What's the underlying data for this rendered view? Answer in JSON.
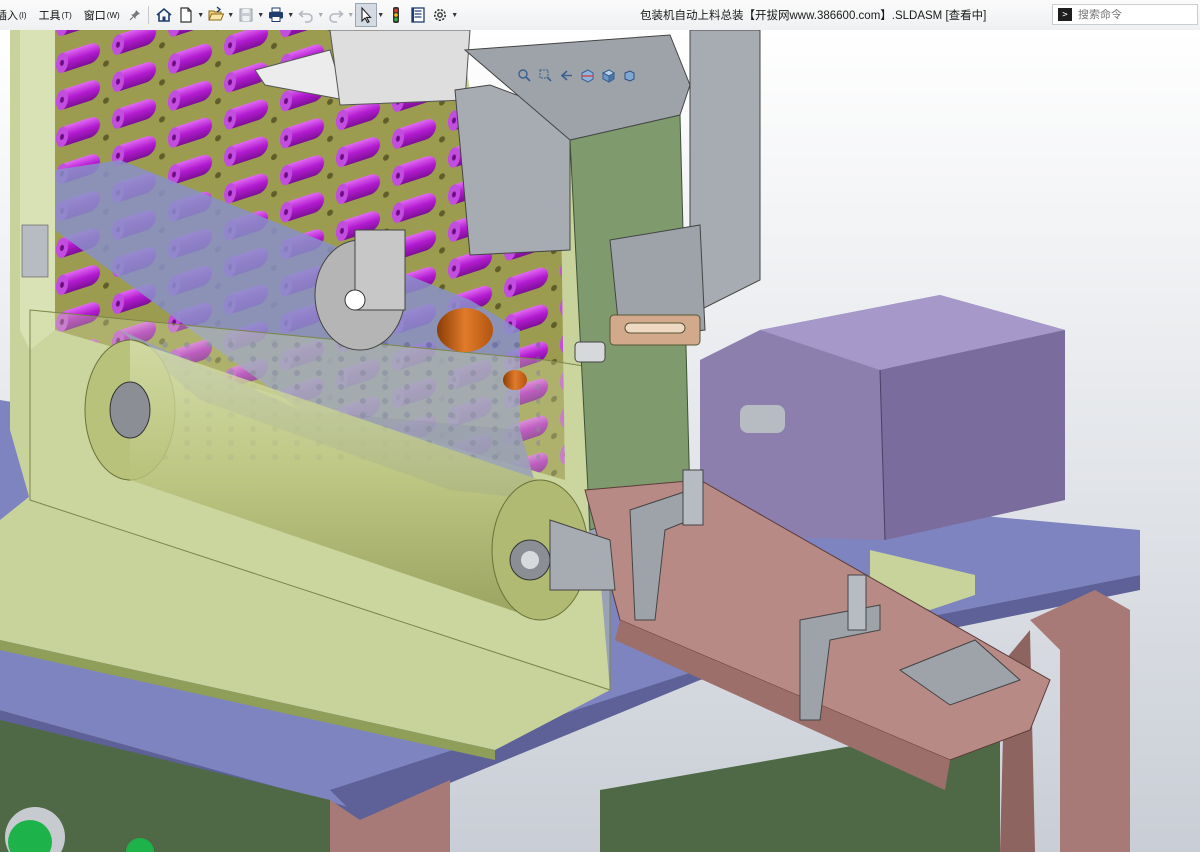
{
  "menu": {
    "insert": "插入",
    "insert_acc": "(I)",
    "tools": "工具",
    "tools_acc": "(T)",
    "window": "窗口",
    "window_acc": "(W)"
  },
  "toolbar": {
    "icons": [
      "pin-icon",
      "home-icon",
      "new-document-icon",
      "open-folder-icon",
      "save-icon",
      "print-icon",
      "undo-icon",
      "redo-icon",
      "select-pointer-icon",
      "rebuild-traffic-light-icon",
      "file-properties-icon",
      "options-gear-icon"
    ],
    "active_tool": "select-pointer-icon"
  },
  "document": {
    "title": "包装机自动上料总装【开拔网www.386600.com】.SLDASM [查看中]"
  },
  "search": {
    "placeholder": "搜索命令"
  },
  "heads_up": {
    "icons": [
      "zoom-to-fit-icon",
      "zoom-area-icon",
      "previous-view-icon",
      "section-view-icon",
      "view-orientation-icon",
      "display-style-icon"
    ]
  },
  "colors": {
    "background_top": "#ffffff",
    "background_bottom": "#c9ced6",
    "frame_green": "#c8d39c",
    "frame_green_dark": "#8f9e58",
    "rollers_magenta": "#b21bd0",
    "plate_blue": "#7d84bf",
    "plate_blue_dark": "#5d6198",
    "motor_purple": "#8c7fae",
    "chute_pink": "#b88a86",
    "panel_green": "#7f9a6d",
    "bracket_grey": "#9ea3aa",
    "leg_dark_green": "#4f6946",
    "orange_part": "#d26a1e"
  }
}
